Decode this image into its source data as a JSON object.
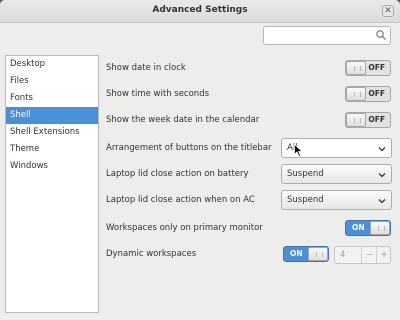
{
  "window": {
    "title": "Advanced Settings",
    "close_glyph": "✕"
  },
  "search": {
    "value": "",
    "placeholder": "",
    "icon": "search-icon"
  },
  "sidebar": {
    "items": [
      {
        "label": "Desktop",
        "selected": false
      },
      {
        "label": "Files",
        "selected": false
      },
      {
        "label": "Fonts",
        "selected": false
      },
      {
        "label": "Shell",
        "selected": true
      },
      {
        "label": "Shell Extensions",
        "selected": false
      },
      {
        "label": "Theme",
        "selected": false
      },
      {
        "label": "Windows",
        "selected": false
      }
    ]
  },
  "settings": {
    "show_date": {
      "label": "Show date in clock",
      "state": "OFF"
    },
    "show_seconds": {
      "label": "Show time with seconds",
      "state": "OFF"
    },
    "week_date": {
      "label": "Show the week date in the calendar",
      "state": "OFF"
    },
    "titlebar_buttons": {
      "label": "Arrangement of buttons on the titlebar",
      "value": "All"
    },
    "lid_battery": {
      "label": "Laptop lid close action on battery",
      "value": "Suspend"
    },
    "lid_ac": {
      "label": "Laptop lid close action when on AC",
      "value": "Suspend"
    },
    "workspaces_primary": {
      "label": "Workspaces only on primary monitor",
      "state": "ON"
    },
    "dynamic_workspaces": {
      "label": "Dynamic workspaces",
      "state": "ON",
      "count": "4",
      "minus": "−",
      "plus": "+"
    }
  },
  "colors": {
    "accent": "#4a90d9",
    "window_bg": "#ededec"
  }
}
